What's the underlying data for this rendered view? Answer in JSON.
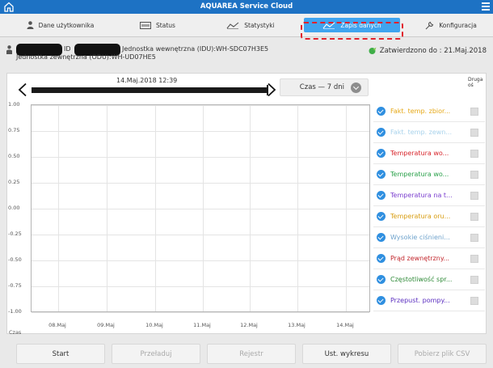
{
  "app": {
    "title": "AQUAREA Service Cloud"
  },
  "tabs": [
    {
      "label": "Dane użytkownika",
      "icon": "user-icon",
      "active": false
    },
    {
      "label": "Status",
      "icon": "status-icon",
      "active": false
    },
    {
      "label": "Statystyki",
      "icon": "statistics-icon",
      "active": false
    },
    {
      "label": "Zapis danych",
      "icon": "data-log-icon",
      "active": true
    },
    {
      "label": "Konfiguracja",
      "icon": "wrench-icon",
      "active": false
    }
  ],
  "info": {
    "id_label": "ID",
    "idu_text": "Jednostka wewnętrzna (IDU):WH-SDC07H3E5",
    "odu_text": "Jednostka zewnętrzna (ODU):WH-UD07HE5",
    "approved_text": "Zatwierdzono do : 21.Maj.2018"
  },
  "chart_controls": {
    "date_label": "14.Maj.2018 12:39",
    "period_label": "Czas — 7 dni"
  },
  "legend": {
    "header": "Druga oś",
    "items": [
      {
        "label": "Fakt. temp. zbior...",
        "color": "#e6a817"
      },
      {
        "label": "Fakt. temp. zewn...",
        "color": "#a9d3ec"
      },
      {
        "label": "Temperatura wo...",
        "color": "#d8262c"
      },
      {
        "label": "Temperatura wo...",
        "color": "#2aa14a"
      },
      {
        "label": "Temperatura na t...",
        "color": "#7b3fcf"
      },
      {
        "label": "Temperatura oru...",
        "color": "#d89d12"
      },
      {
        "label": "Wysokie ciśnieni...",
        "color": "#6fa3cc"
      },
      {
        "label": "Prąd zewnętrzny...",
        "color": "#c2262c"
      },
      {
        "label": "Częstotliwość spr...",
        "color": "#2f8a38"
      },
      {
        "label": "Przepust. pompy...",
        "color": "#5b2fc0"
      }
    ]
  },
  "chart_data": {
    "type": "line",
    "xlabel": "Czas",
    "ylabel": "",
    "ylim": [
      -1.0,
      1.0
    ],
    "y_ticks": [
      "1.00",
      "0.75",
      "0.50",
      "0.25",
      "0.00",
      "-0.25",
      "-0.50",
      "-0.75",
      "-1.00"
    ],
    "x_ticks": [
      "08.Maj",
      "09.Maj",
      "10.Maj",
      "11.Maj",
      "12.Maj",
      "13.Maj",
      "14.Maj"
    ],
    "series": []
  },
  "buttons": {
    "start": "Start",
    "reload": "Przeładuj",
    "register": "Rejestr",
    "chart_settings": "Ust. wykresu",
    "download_csv": "Pobierz plik CSV"
  }
}
